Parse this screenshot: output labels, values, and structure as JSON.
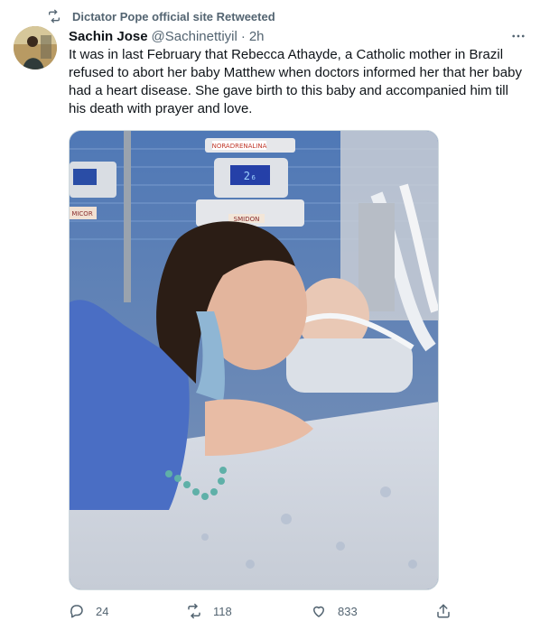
{
  "retweet_banner": {
    "text": "Dictator Pope official site Retweeted",
    "icon": "retweet-icon"
  },
  "author": {
    "display_name": "Sachin Jose",
    "handle": "@Sachinettiyil",
    "separator": "·",
    "time": "2h"
  },
  "menu": {
    "icon": "more-icon",
    "label": "···"
  },
  "tweet": {
    "text": "It was in last February that Rebecca Athayde, a Catholic mother in Brazil refused to abort her baby Matthew when doctors informed her that her baby had a heart disease. She gave birth to this baby and accompanied him till his death with prayer and love."
  },
  "media": {
    "monitor_labels": [
      "NORADRENALINA",
      "MICOF",
      "SMIDON",
      "MICOR"
    ],
    "monitor_reading": "2₆"
  },
  "actions": {
    "reply": {
      "icon": "reply-icon",
      "count": "24"
    },
    "retweet": {
      "icon": "retweet-icon",
      "count": "118"
    },
    "like": {
      "icon": "heart-icon",
      "count": "833"
    },
    "share": {
      "icon": "share-icon"
    }
  },
  "colors": {
    "text_primary": "#0f1419",
    "text_secondary": "#536471",
    "border": "#cfd9de"
  }
}
